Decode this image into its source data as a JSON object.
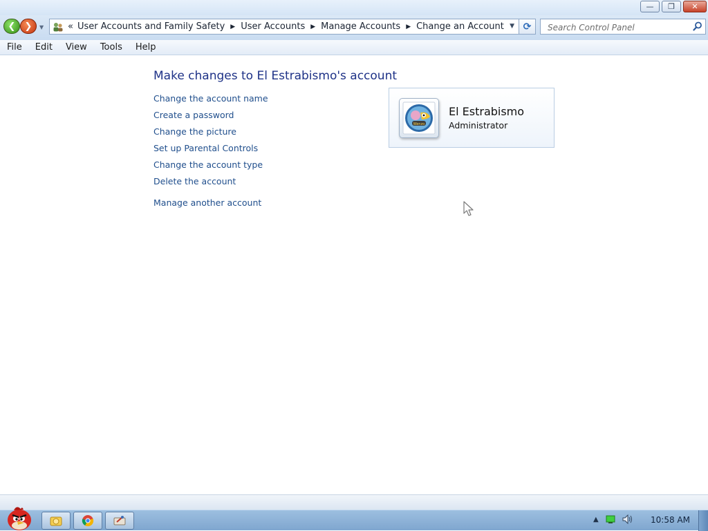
{
  "window": {
    "minimize_label": "—",
    "maximize_label": "❐",
    "close_label": "✕"
  },
  "navigation": {
    "back_glyph": "❮",
    "forward_glyph": "❯",
    "recent_glyph": "▼"
  },
  "address_bar": {
    "overflow_glyph": "«",
    "separator_glyph": "▶",
    "breadcrumbs": [
      "User Accounts and Family Safety",
      "User Accounts",
      "Manage Accounts",
      "Change an Account"
    ],
    "dropdown_glyph": "▼",
    "refresh_glyph": "⟳"
  },
  "search": {
    "placeholder": "Search Control Panel"
  },
  "menu": {
    "items": [
      "File",
      "Edit",
      "View",
      "Tools",
      "Help"
    ]
  },
  "main": {
    "title": "Make changes to El Estrabismo's account",
    "tasks": [
      "Change the account name",
      "Create a password",
      "Change the picture",
      "Set up Parental Controls",
      "Change the account type",
      "Delete the account"
    ],
    "other_task": "Manage another account"
  },
  "account": {
    "name": "El Estrabismo",
    "type": "Administrator"
  },
  "taskbar": {
    "clock": "10:58 AM"
  },
  "colors": {
    "link": "#1f4e8c",
    "title": "#1e3287",
    "taskbar": "#8fb2d8"
  }
}
